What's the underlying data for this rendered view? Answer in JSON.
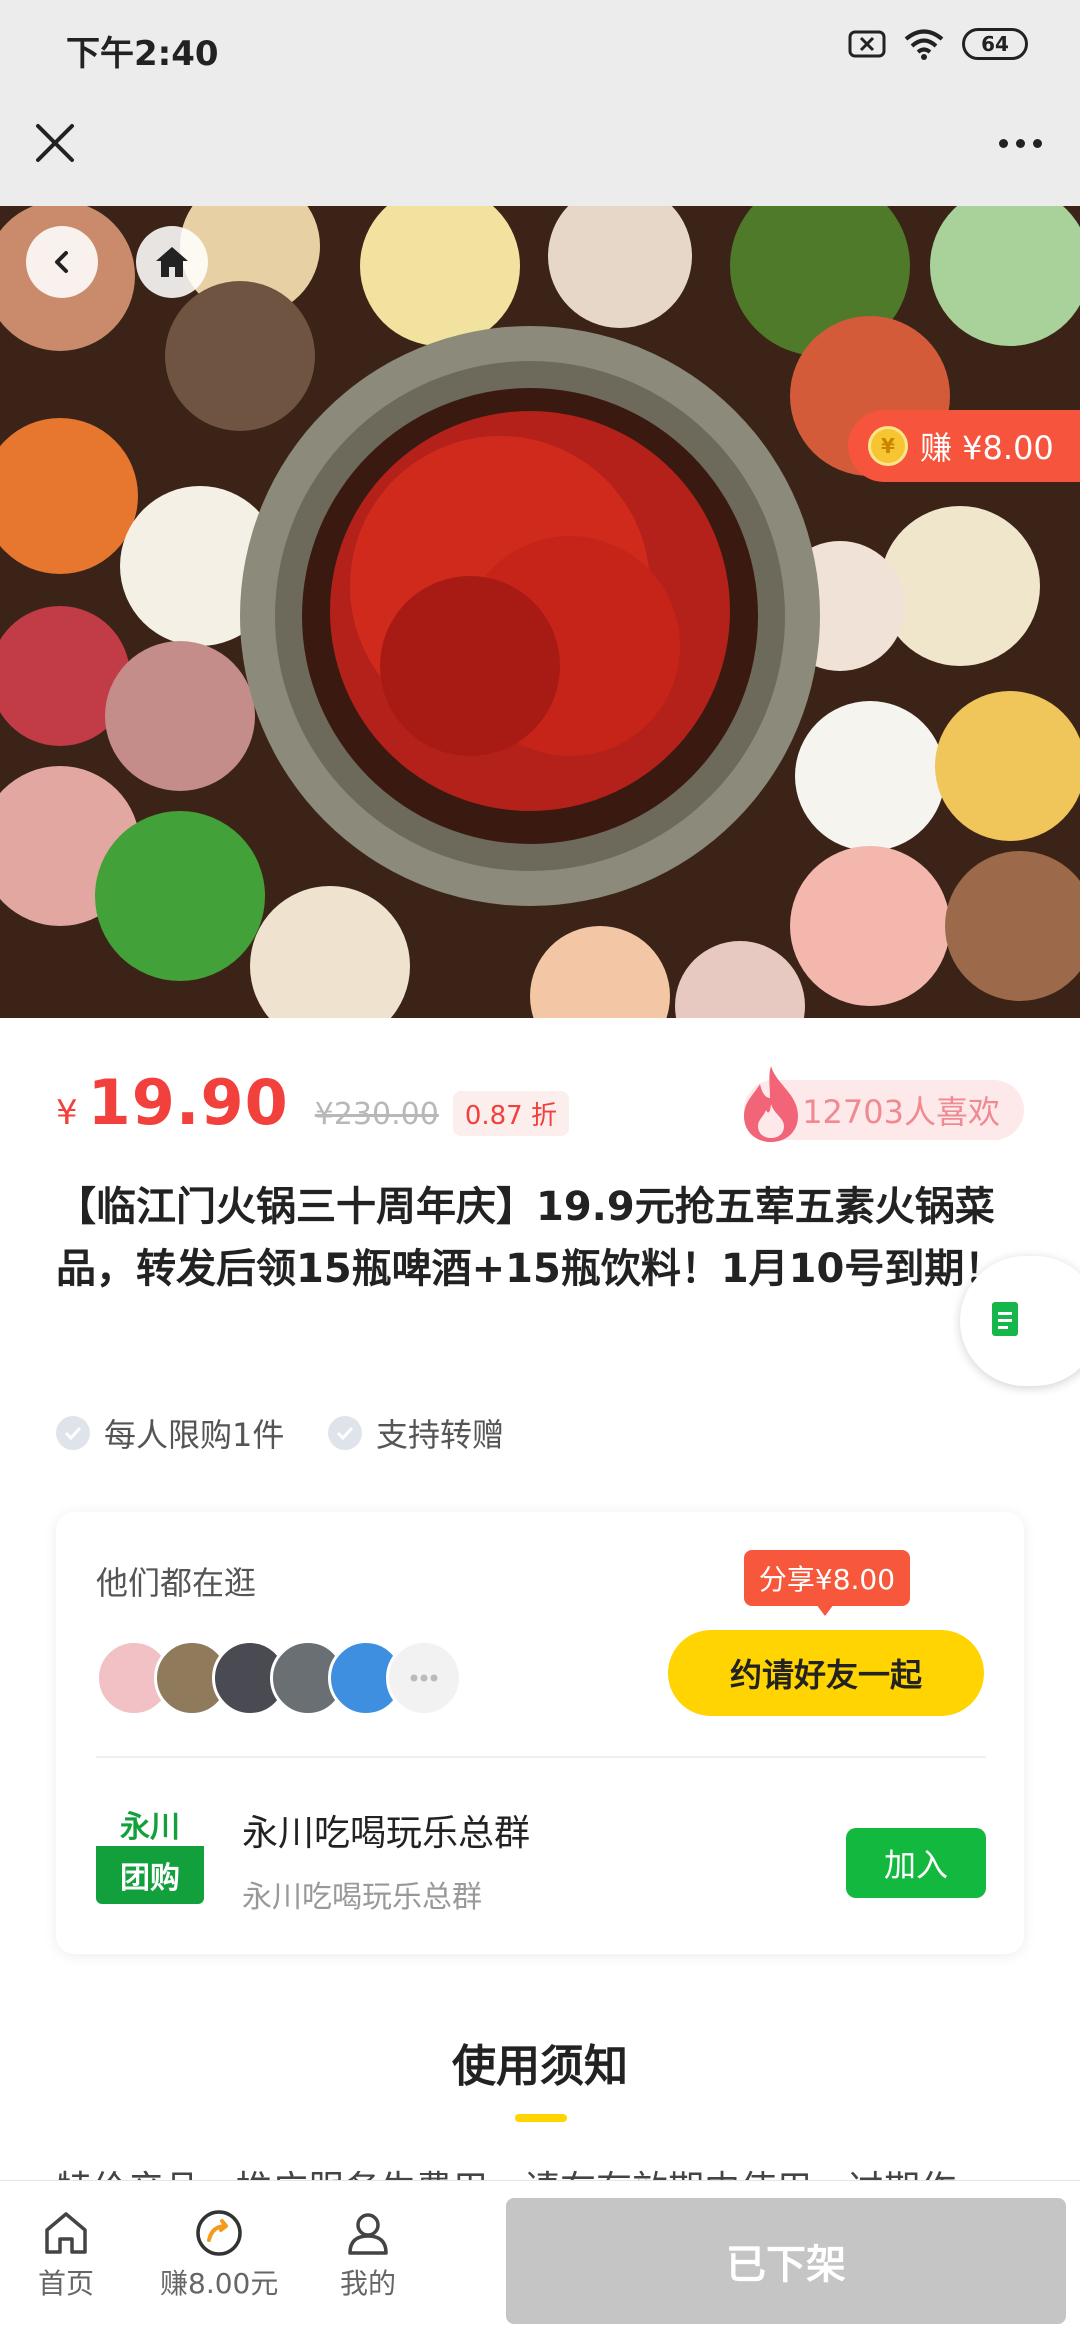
{
  "status_bar": {
    "time": "下午2:40",
    "battery": "64"
  },
  "hero": {
    "earn_label": "赚 ¥8.00",
    "coin_symbol": "¥"
  },
  "product": {
    "currency": "¥",
    "price": "19.90",
    "original_price": "¥230.00",
    "discount": "0.87 折",
    "likes": "12703人喜欢",
    "title": "【临江门火锅三十周年庆】19.9元抢五荤五素火锅菜品，转发后领15瓶啤酒+15瓶饮料！1月10号到期！",
    "tags": [
      "每人限购1件",
      "支持转赠"
    ]
  },
  "social": {
    "browsing_label": "他们都在逛",
    "share_badge": "分享¥8.00",
    "invite_label": "约请好友一起",
    "group": {
      "logo_line1": "永川",
      "logo_line2": "团购",
      "name": "永川吃喝玩乐总群",
      "sub": "永川吃喝玩乐总群",
      "join_label": "加入"
    }
  },
  "notice": {
    "title": "使用须知",
    "text": "特价产品，推广服务生费用，请在有效期内使用，过期作"
  },
  "bottom_nav": {
    "home": "首页",
    "earn": "赚8.00元",
    "mine": "我的",
    "action": "已下架"
  },
  "colors": {
    "price_red": "#f2403d",
    "accent_yellow": "#ffd400",
    "join_green": "#12b93e"
  }
}
